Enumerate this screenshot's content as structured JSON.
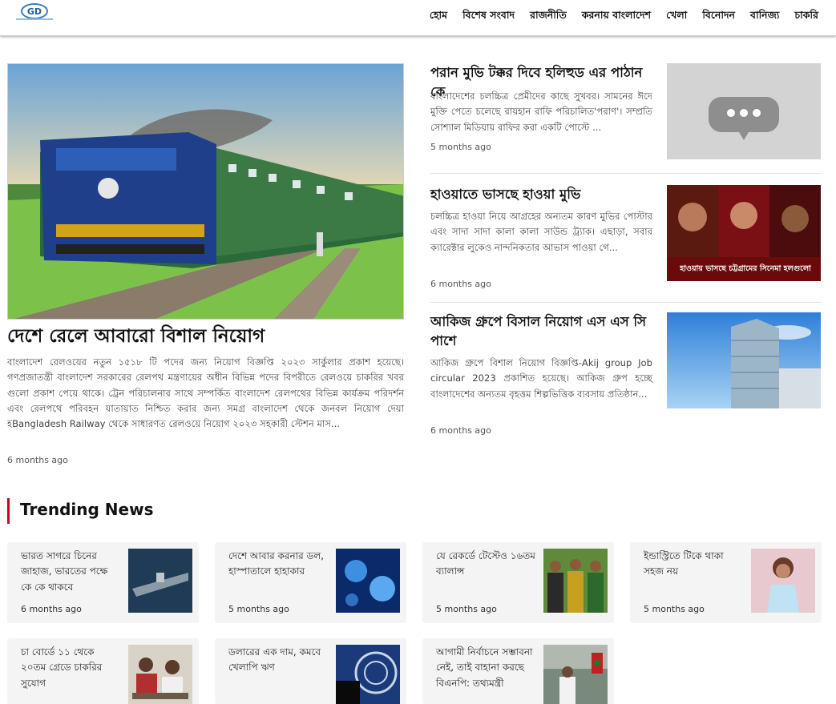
{
  "header": {
    "logo_alt": "Logo",
    "nav": [
      "হোম",
      "বিশেষ সংবাদ",
      "রাজনীতি",
      "করনায় বাংলাদেশ",
      "খেলা",
      "বিনোদন",
      "বানিজ্য",
      "চাকরি"
    ]
  },
  "hero": {
    "title": "দেশে রেলে আবারো বিশাল নিয়োগ",
    "excerpt": "বাংলাদেশ রেলওয়ের নতুন ১৫১৮ টি পদের জন্য নিয়োগ বিজ্ঞপ্তি ২০২৩ সার্কুলার প্রকাশ হয়েছে। গণপ্রজাতন্ত্রী বাংলাদেশ সরকারের রেলপথ মন্ত্রণায়ের অধীন বিভিন্ন পদের বিপরীতে রেলওয়ে চাকরির খবর গুলো প্রকাশ পেয়ে থাকে। ট্রেন পরিচালনার সাথে সম্পর্কিত বাংলাদেশ রেলপথের বিভিন্ন কার্যক্রম পরিদর্শন এবং রেলপথে পরিবহন যাতায়াত নিশ্চিত করার জন্য সমগ্র বাংলাদেশ থেকে জনবল নিয়োগ দেয়া হBangladesh Railway থেকে সাধারণত রেলওয়ে নিয়োগ ২০২৩ সহকারী স্টেশন মাস...",
    "time": "6 months ago"
  },
  "side_stories": [
    {
      "title": "পরান মুভি টক্কর দিবে হলিহুড এর পাঠান কে",
      "excerpt": "বাংলাদেশের চলচ্চিত্র প্রেমীদের কাছে সুখবর। সামনের ঈদে মুক্তি পেতে চলেছে রায়হান রাফি পরিচালিত'পরাণ'। সম্প্রতি সোশ্যাল মিডিয়ায় রাফির করা একটি পোস্টে ...",
      "time": "5 months ago"
    },
    {
      "title": "হাওয়াতে ভাসছে হাওয়া মুভি",
      "excerpt": "চলচ্চিত্র হাওয়া নিয়ে আগ্রহের অন্যতম কারণ মুভির পোস্টার এবং সাদা সাদা কালা কালা সাউন্ড ট্র্যাক। এছাড়া, সবার ক্যারেক্টার লুকেও নান্দনিকতার আভাস পাওয়া গে...",
      "time": "6 months ago",
      "image_caption": "হাওয়ায় ভাসছে চট্টগ্রামের সিনেমা হলগুলো"
    },
    {
      "title": "আকিজ গ্রুপে বিসাল নিয়োগ এস এস সি পাশে",
      "excerpt": "আকিজ গ্রুপে বিশাল নিয়োগ বিজ্ঞপ্তি-Akij group Job circular 2023 প্রকাশিত হয়েছে। আকিজ গ্রুপ হচ্ছে বাংলাদেশের অন্যতম বৃহত্তম শিল্পভিত্তিক ব্যবসায় প্রতিষ্ঠান...",
      "time": "6 months ago"
    }
  ],
  "trending": {
    "heading": "Trending News",
    "cards": [
      {
        "title": "ভারত সাগরে চিনের জাহাজ, ভারতের পক্ষে কে কে থাকবে",
        "time": "6 months ago"
      },
      {
        "title": "দেশে আবার করনার ডল, হাস্পাতালে হাহাকার",
        "time": "5 months ago"
      },
      {
        "title": "যে রেকর্ডে টেস্টেও ১৬তম ব্যালান্স",
        "time": "5 months ago"
      },
      {
        "title": "ইন্ডাস্ট্রিতে টিকে থাকা সহজ নয়",
        "time": "5 months ago"
      },
      {
        "title": "চা বোর্ডে ১১ থেকে ২০তম গ্রেডে চাকরির সুযোগ",
        "time": ""
      },
      {
        "title": "ডলারের এক দাম, কমবে খেলাপি ঋণ",
        "time": ""
      },
      {
        "title": "আগামী নির্বাচনে সম্ভাবনা নেই, তাই বাহানা করছে বিএনপি: তথ্যমন্ত্রী",
        "time": ""
      }
    ]
  },
  "colors": {
    "accent_red": "#d0021b",
    "card_bg": "#f4f4f4"
  }
}
